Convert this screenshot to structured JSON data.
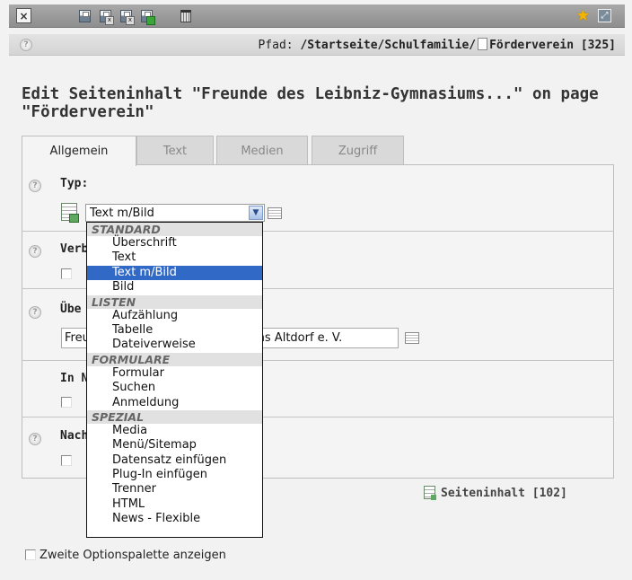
{
  "toolbar": {
    "icons": [
      "close-icon",
      "save-icon",
      "save-view-icon",
      "save-close-icon",
      "save-new-icon",
      "delete-icon",
      "shortcut-star-icon",
      "fullscreen-icon"
    ]
  },
  "path": {
    "label": "Pfad:",
    "trail": "/Startseite/Schulfamilie/",
    "page": "Förderverein [325]"
  },
  "heading": "Edit Seiteninhalt \"Freunde des Leibniz-Gymnasiums...\" on page \"Förderverein\"",
  "tabs": [
    {
      "label": "Allgemein",
      "active": true
    },
    {
      "label": "Text",
      "active": false
    },
    {
      "label": "Medien",
      "active": false
    },
    {
      "label": "Zugriff",
      "active": false
    }
  ],
  "fields": {
    "typ_label": "Typ:",
    "typ_value": "Text m/Bild",
    "verbergen_label": "Verb",
    "ueberschrift_label": "Übe",
    "ueberschrift_value_left": "Freu",
    "ueberschrift_value_right": "ums Altdorf e. V.",
    "in_nav_label": "In N",
    "nachher_label": "Nach"
  },
  "dropdown": {
    "groups": [
      {
        "label": "STANDARD",
        "options": [
          "Überschrift",
          "Text",
          "Text m/Bild",
          "Bild"
        ]
      },
      {
        "label": "LISTEN",
        "options": [
          "Aufzählung",
          "Tabelle",
          "Dateiverweise"
        ]
      },
      {
        "label": "FORMULARE",
        "options": [
          "Formular",
          "Suchen",
          "Anmeldung"
        ]
      },
      {
        "label": "SPEZIAL",
        "options": [
          "Media",
          "Menü/Sitemap",
          "Datensatz einfügen",
          "Plug-In einfügen",
          "Trenner",
          "HTML",
          "News - Flexible"
        ]
      }
    ],
    "selected": "Text m/Bild"
  },
  "record": "Seiteninhalt [102]",
  "second_palette_label": "Zweite Optionspalette anzeigen",
  "colors": {
    "selection": "#3169c6",
    "toolbar": "#9c9c9c",
    "panel": "#f4f4f4"
  }
}
